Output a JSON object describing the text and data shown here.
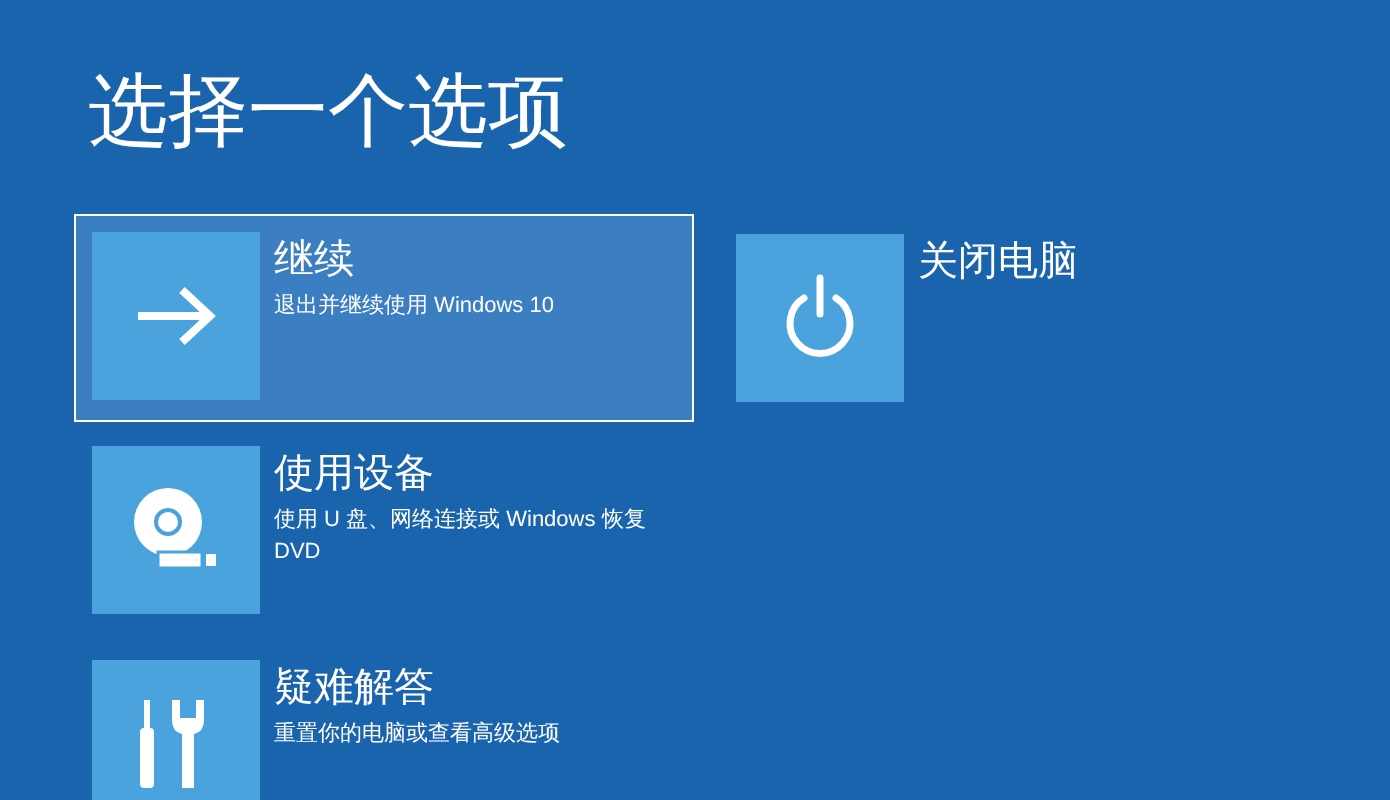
{
  "title": "选择一个选项",
  "columns": [
    [
      {
        "kind": "continue",
        "title": "继续",
        "description": "退出并继续使用 Windows 10",
        "selected": true
      },
      {
        "kind": "device",
        "title": "使用设备",
        "description": "使用 U 盘、网络连接或 Windows 恢复 DVD",
        "selected": false
      },
      {
        "kind": "troubleshoot",
        "title": "疑难解答",
        "description": "重置你的电脑或查看高级选项",
        "selected": false
      }
    ],
    [
      {
        "kind": "power",
        "title": "关闭电脑",
        "selected": false
      }
    ]
  ]
}
